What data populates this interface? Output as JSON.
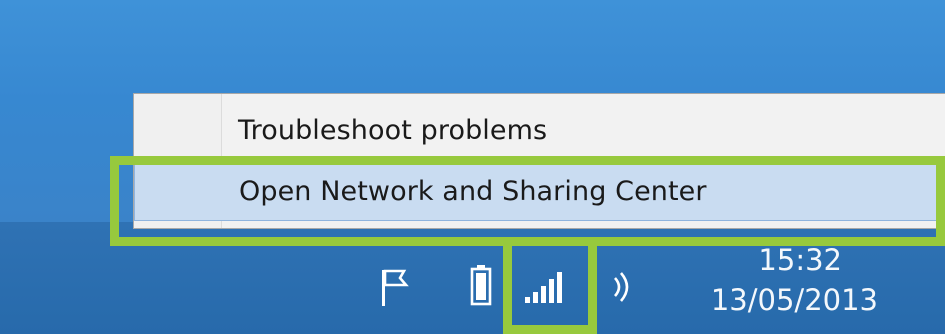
{
  "context_menu": {
    "items": [
      {
        "label": "Troubleshoot problems"
      },
      {
        "label": "Open Network and Sharing Center"
      }
    ]
  },
  "taskbar": {
    "tray_icons": [
      "flag-icon",
      "battery-icon",
      "network-signal-icon",
      "volume-icon"
    ],
    "clock": {
      "time": "15:32",
      "date": "13/05/2013"
    }
  },
  "colors": {
    "desktop_background": "#3788d1",
    "taskbar_background": "#2a6eaf",
    "highlight_outline": "#97c93d",
    "menu_hover": "#c9dcf1"
  }
}
